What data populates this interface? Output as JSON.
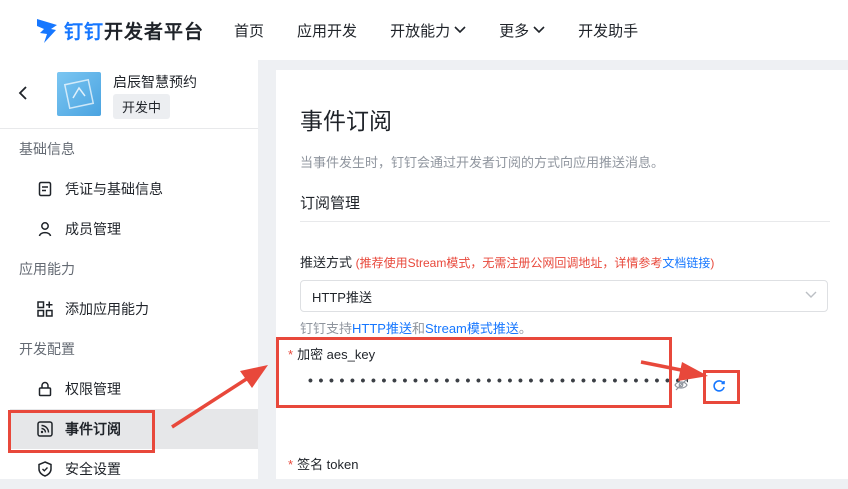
{
  "header": {
    "brand_prefix": "钉钉",
    "brand_suffix": "开发者平台",
    "nav": [
      {
        "label": "首页"
      },
      {
        "label": "应用开发"
      },
      {
        "label": "开放能力"
      },
      {
        "label": "更多"
      },
      {
        "label": "开发助手"
      }
    ]
  },
  "sidebar": {
    "app_name": "启辰智慧预约",
    "app_status": "开发中",
    "groups": [
      {
        "title": "基础信息",
        "items": [
          {
            "label": "凭证与基础信息"
          },
          {
            "label": "成员管理"
          }
        ]
      },
      {
        "title": "应用能力",
        "items": [
          {
            "label": "添加应用能力"
          }
        ]
      },
      {
        "title": "开发配置",
        "items": [
          {
            "label": "权限管理"
          },
          {
            "label": "事件订阅"
          },
          {
            "label": "安全设置"
          }
        ]
      }
    ]
  },
  "main": {
    "title": "事件订阅",
    "description": "当事件发生时，钉钉会通过开发者订阅的方式向应用推送消息。",
    "section_title": "订阅管理",
    "push_label": "推送方式",
    "push_hint": "(推荐使用Stream模式，无需注册公网回调地址，详情参考",
    "push_hint_link": "文档链接",
    "push_hint_end": ")",
    "push_value": "HTTP推送",
    "support_prefix": "钉钉支持",
    "support_link1": "HTTP推送",
    "support_mid": "和",
    "support_link2": "Stream模式推送",
    "support_end": "。",
    "required_mark": "*",
    "aes_label": "加密 aes_key",
    "aes_value": "••••••••••••••••••••••••••••••••••••••••••••",
    "token_label": "签名 token"
  },
  "colors": {
    "accent": "#1677ff",
    "annotation": "#e8483b"
  }
}
